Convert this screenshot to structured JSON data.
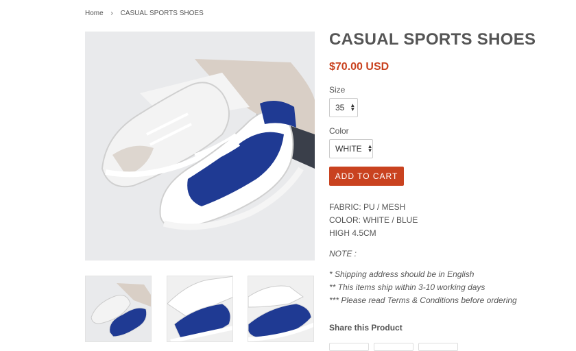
{
  "breadcrumb": {
    "home": "Home",
    "separator": "›",
    "current": "CASUAL SPORTS SHOES"
  },
  "product": {
    "title": "CASUAL SPORTS SHOES",
    "price": "$70.00 USD",
    "size_label": "Size",
    "size_value": "35",
    "color_label": "Color",
    "color_value": "WHITE",
    "add_to_cart": "ADD TO CART",
    "description": [
      "FABRIC: PU / MESH",
      "COLOR: WHITE / BLUE",
      "HIGH 4.5CM"
    ],
    "note_label": "NOTE :",
    "notes": [
      "* Shipping address should be in English",
      "** This items ship within 3-10 working days",
      "*** Please read Terms & Conditions before ordering"
    ],
    "share_title": "Share this Product"
  },
  "colors": {
    "accent": "#c9421f",
    "text": "#555555",
    "shoe_blue": "#1f3a93",
    "image_bg": "#e9eaec"
  }
}
